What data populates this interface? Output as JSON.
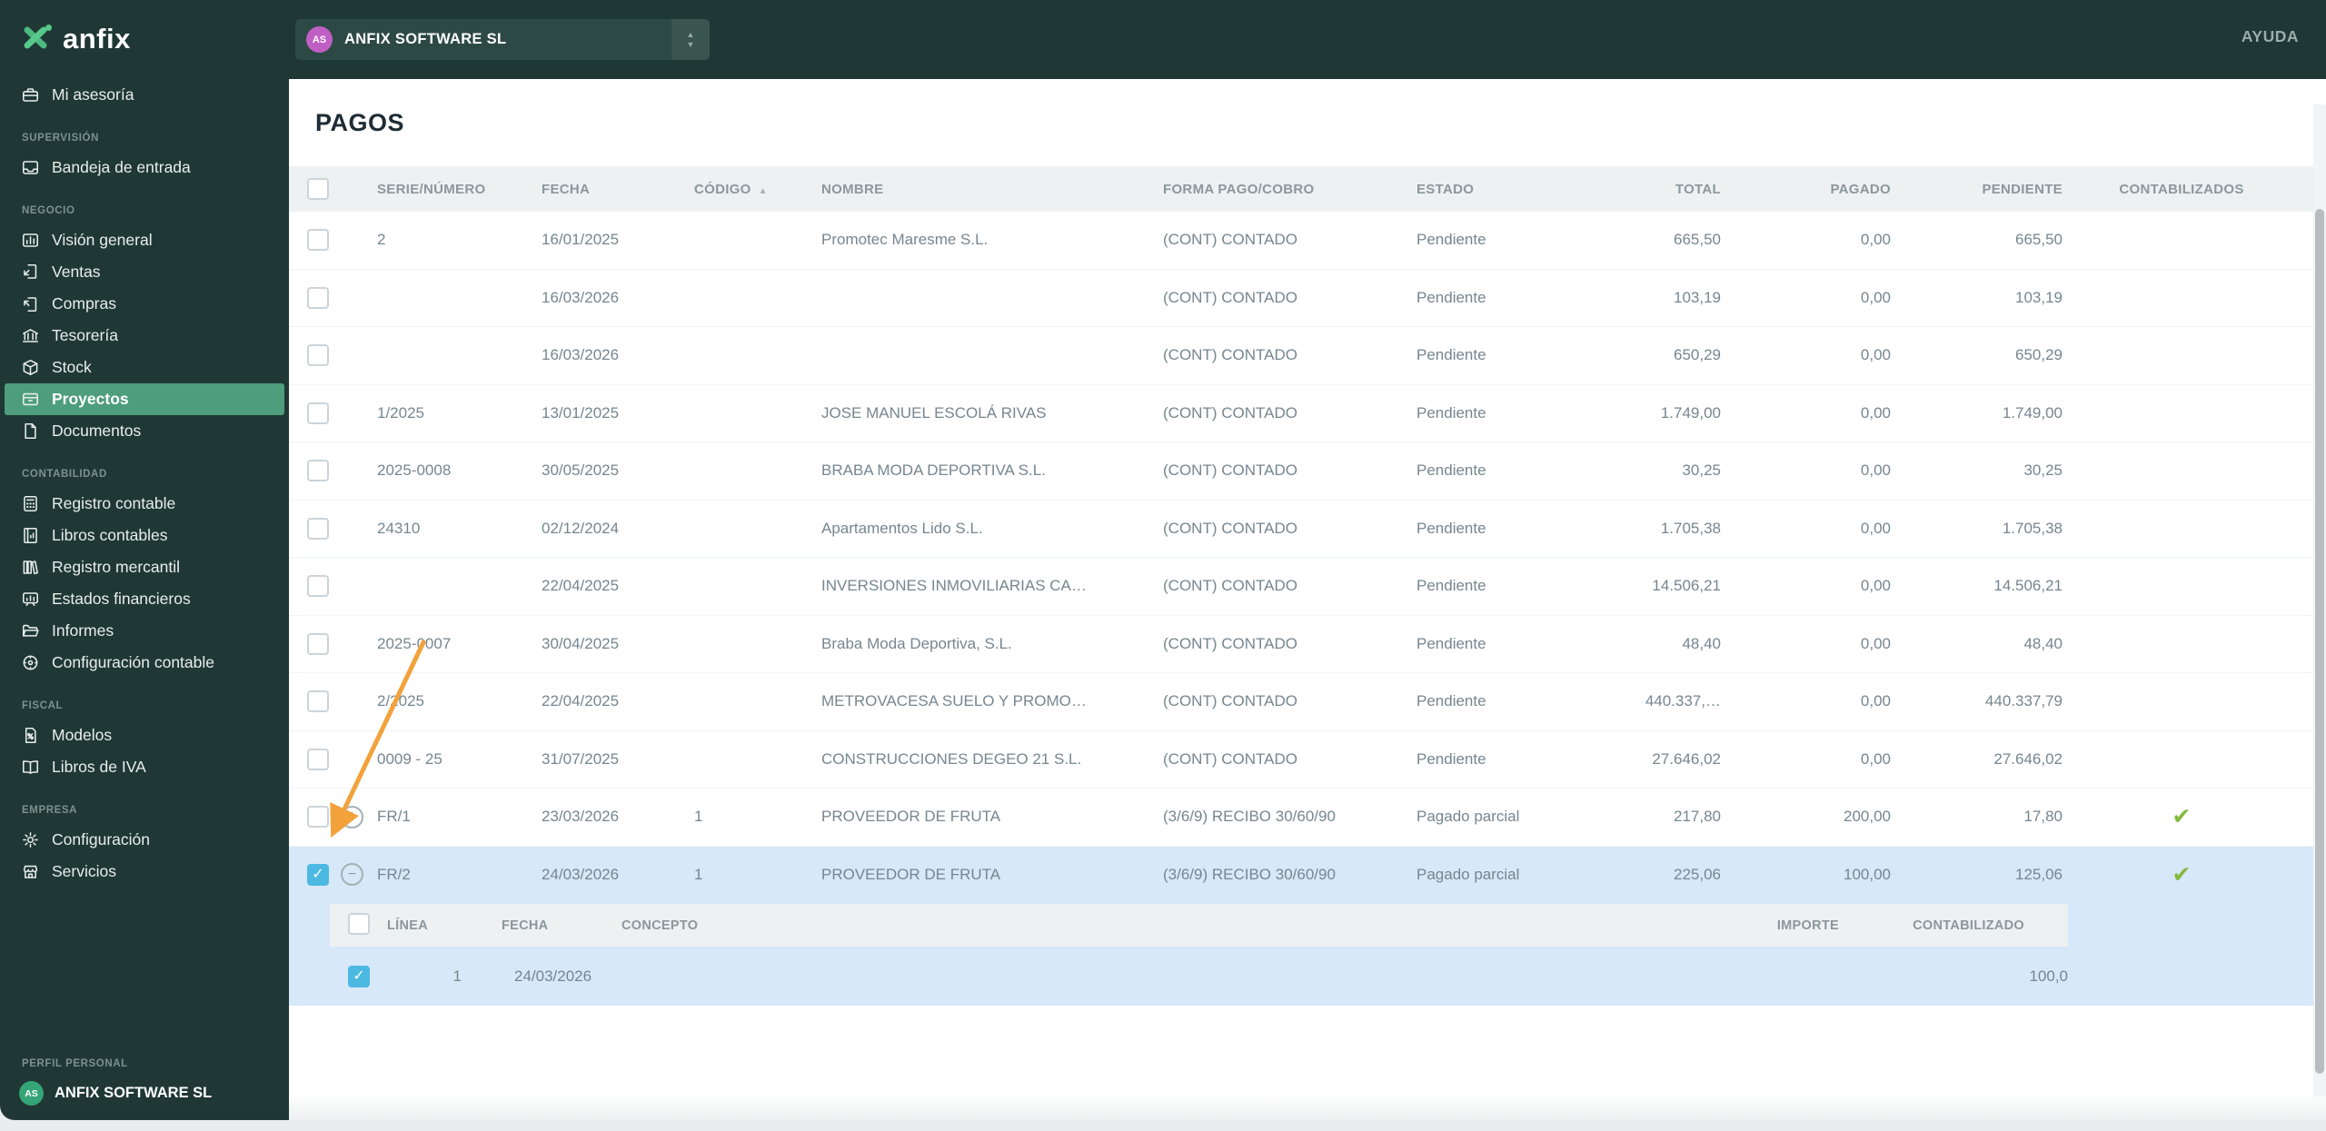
{
  "topbar": {
    "company_selector": {
      "initials": "AS",
      "name": "ANFIX SOFTWARE SL"
    },
    "help_label": "AYUDA"
  },
  "sidebar": {
    "logo_text": "anfix",
    "groups": [
      {
        "label": "",
        "items": [
          {
            "icon": "briefcase-icon",
            "label": "Mi asesoría"
          }
        ]
      },
      {
        "label": "SUPERVISIÓN",
        "items": [
          {
            "icon": "inbox-icon",
            "label": "Bandeja de entrada"
          }
        ]
      },
      {
        "label": "NEGOCIO",
        "items": [
          {
            "icon": "bar-chart-icon",
            "label": "Visión general"
          },
          {
            "icon": "sales-document-icon",
            "label": "Ventas"
          },
          {
            "icon": "purchases-document-icon",
            "label": "Compras"
          },
          {
            "icon": "bank-icon",
            "label": "Tesorería"
          },
          {
            "icon": "box-icon",
            "label": "Stock"
          },
          {
            "icon": "archive-drawer-icon",
            "label": "Proyectos",
            "active": true
          },
          {
            "icon": "document-icon",
            "label": "Documentos"
          }
        ]
      },
      {
        "label": "CONTABILIDAD",
        "items": [
          {
            "icon": "calculator-icon",
            "label": "Registro contable"
          },
          {
            "icon": "ledger-book-icon",
            "label": "Libros contables"
          },
          {
            "icon": "bookshelf-icon",
            "label": "Registro mercantil"
          },
          {
            "icon": "financial-board-icon",
            "label": "Estados financieros"
          },
          {
            "icon": "folder-icon",
            "label": "Informes"
          },
          {
            "icon": "gear-circle-icon",
            "label": "Configuración contable"
          }
        ]
      },
      {
        "label": "FISCAL",
        "items": [
          {
            "icon": "document-percent-icon",
            "label": "Modelos"
          },
          {
            "icon": "open-book-icon",
            "label": "Libros de IVA"
          }
        ]
      },
      {
        "label": "EMPRESA",
        "items": [
          {
            "icon": "gear-icon",
            "label": "Configuración"
          },
          {
            "icon": "storefront-icon",
            "label": "Servicios"
          }
        ]
      }
    ],
    "profile": {
      "label": "PERFIL PERSONAL",
      "initials": "AS",
      "name": "ANFIX SOFTWARE SL"
    }
  },
  "page": {
    "title": "PAGOS"
  },
  "table": {
    "columns": [
      "SERIE/NÚMERO",
      "FECHA",
      "CÓDIGO",
      "NOMBRE",
      "FORMA PAGO/COBRO",
      "ESTADO",
      "TOTAL",
      "PAGADO",
      "PENDIENTE",
      "CONTABILIZADOS"
    ],
    "sort_column": "CÓDIGO",
    "sort_direction": "asc",
    "rows": [
      {
        "serie": "2",
        "fecha": "16/01/2025",
        "codigo": "",
        "nombre": "Promotec Maresme S.L.",
        "forma_pago": "(CONT) CONTADO",
        "estado": "Pendiente",
        "total": "665,50",
        "pagado": "0,00",
        "pendiente": "665,50",
        "contabilizado": false,
        "checked": false,
        "selected": false,
        "expander": null
      },
      {
        "serie": "",
        "fecha": "16/03/2026",
        "codigo": "",
        "nombre": "",
        "forma_pago": "(CONT) CONTADO",
        "estado": "Pendiente",
        "total": "103,19",
        "pagado": "0,00",
        "pendiente": "103,19",
        "contabilizado": false,
        "checked": false,
        "selected": false,
        "expander": null
      },
      {
        "serie": "",
        "fecha": "16/03/2026",
        "codigo": "",
        "nombre": "",
        "forma_pago": "(CONT) CONTADO",
        "estado": "Pendiente",
        "total": "650,29",
        "pagado": "0,00",
        "pendiente": "650,29",
        "contabilizado": false,
        "checked": false,
        "selected": false,
        "expander": null
      },
      {
        "serie": "1/2025",
        "fecha": "13/01/2025",
        "codigo": "",
        "nombre": "JOSE MANUEL ESCOLÁ RIVAS",
        "forma_pago": "(CONT) CONTADO",
        "estado": "Pendiente",
        "total": "1.749,00",
        "pagado": "0,00",
        "pendiente": "1.749,00",
        "contabilizado": false,
        "checked": false,
        "selected": false,
        "expander": null
      },
      {
        "serie": "2025-0008",
        "fecha": "30/05/2025",
        "codigo": "",
        "nombre": "BRABA MODA DEPORTIVA S.L.",
        "forma_pago": "(CONT) CONTADO",
        "estado": "Pendiente",
        "total": "30,25",
        "pagado": "0,00",
        "pendiente": "30,25",
        "contabilizado": false,
        "checked": false,
        "selected": false,
        "expander": null
      },
      {
        "serie": "24310",
        "fecha": "02/12/2024",
        "codigo": "",
        "nombre": "Apartamentos Lido S.L.",
        "forma_pago": "(CONT) CONTADO",
        "estado": "Pendiente",
        "total": "1.705,38",
        "pagado": "0,00",
        "pendiente": "1.705,38",
        "contabilizado": false,
        "checked": false,
        "selected": false,
        "expander": null
      },
      {
        "serie": "",
        "fecha": "22/04/2025",
        "codigo": "",
        "nombre": "INVERSIONES INMOVILIARIAS CA…",
        "forma_pago": "(CONT) CONTADO",
        "estado": "Pendiente",
        "total": "14.506,21",
        "pagado": "0,00",
        "pendiente": "14.506,21",
        "contabilizado": false,
        "checked": false,
        "selected": false,
        "expander": null
      },
      {
        "serie": "2025-0007",
        "fecha": "30/04/2025",
        "codigo": "",
        "nombre": "Braba Moda Deportiva, S.L.",
        "forma_pago": "(CONT) CONTADO",
        "estado": "Pendiente",
        "total": "48,40",
        "pagado": "0,00",
        "pendiente": "48,40",
        "contabilizado": false,
        "checked": false,
        "selected": false,
        "expander": null
      },
      {
        "serie": "2/2025",
        "fecha": "22/04/2025",
        "codigo": "",
        "nombre": "METROVACESA SUELO Y PROMO…",
        "forma_pago": "(CONT) CONTADO",
        "estado": "Pendiente",
        "total": "440.337,…",
        "pagado": "0,00",
        "pendiente": "440.337,79",
        "contabilizado": false,
        "checked": false,
        "selected": false,
        "expander": null
      },
      {
        "serie": "0009 - 25",
        "fecha": "31/07/2025",
        "codigo": "",
        "nombre": "CONSTRUCCIONES DEGEO 21 S.L.",
        "forma_pago": "(CONT) CONTADO",
        "estado": "Pendiente",
        "total": "27.646,02",
        "pagado": "0,00",
        "pendiente": "27.646,02",
        "contabilizado": false,
        "checked": false,
        "selected": false,
        "expander": null
      },
      {
        "serie": "FR/1",
        "fecha": "23/03/2026",
        "codigo": "1",
        "nombre": "PROVEEDOR DE FRUTA",
        "forma_pago": "(3/6/9) RECIBO 30/60/90",
        "estado": "Pagado parcial",
        "total": "217,80",
        "pagado": "200,00",
        "pendiente": "17,80",
        "contabilizado": true,
        "checked": false,
        "selected": false,
        "expander": "plus"
      },
      {
        "serie": "FR/2",
        "fecha": "24/03/2026",
        "codigo": "1",
        "nombre": "PROVEEDOR DE FRUTA",
        "forma_pago": "(3/6/9) RECIBO 30/60/90",
        "estado": "Pagado parcial",
        "total": "225,06",
        "pagado": "100,00",
        "pendiente": "125,06",
        "contabilizado": true,
        "checked": true,
        "selected": true,
        "expander": "minus"
      }
    ],
    "subtable": {
      "columns": [
        "LÍNEA",
        "FECHA",
        "CONCEPTO",
        "IMPORTE",
        "CONTABILIZADO"
      ],
      "rows": [
        {
          "checked": true,
          "linea": "1",
          "fecha": "24/03/2026",
          "concepto": "",
          "importe": "100,0"
        }
      ]
    }
  },
  "colors": {
    "chrome_background": "#1f3835",
    "sidebar_active": "#4e9d7d",
    "selected_row": "#d7e8f8",
    "checkbox_checked": "#4cb9e2",
    "check_green": "#82b93f",
    "annotation_arrow": "#f2a23b",
    "avatar_purple": "#c05fc3",
    "avatar_green": "#35a476"
  }
}
